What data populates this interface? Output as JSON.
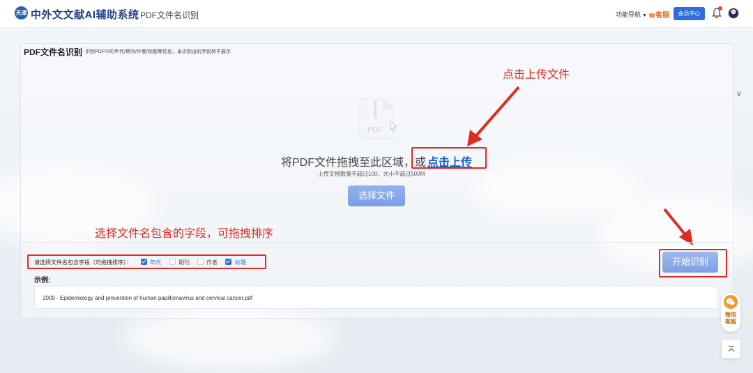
{
  "header": {
    "logo_text": "天津",
    "app_title": "中外文文献AI辅助系统",
    "page_crumb": "PDF文件名识别",
    "nav_menu": "功能导航",
    "kefu": "客服",
    "member_center": "会员中心"
  },
  "card": {
    "title": "PDF文件名识别",
    "subtitle": "识别PDF中的年代/期刊/作者/标题等信息，未识别出的字段将不展示"
  },
  "upload": {
    "icon_label": "PDF",
    "drop_text": "将PDF文件拖拽至此区域，或",
    "drop_link": "点击上传",
    "limit_text": "上传文档数量不超过100，大小不超过500M",
    "choose_button": "选择文件"
  },
  "annotations": {
    "upload_hint": "点击上传文件",
    "fields_hint": "选择文件名包含的字段，可拖拽排序"
  },
  "fields": {
    "label": "请选择文件名包含字段（可拖拽排序）：",
    "options": [
      {
        "label": "年代",
        "checked": true
      },
      {
        "label": "期刊",
        "checked": false
      },
      {
        "label": "作者",
        "checked": false
      },
      {
        "label": "标题",
        "checked": true
      }
    ]
  },
  "start_button": "开始识别",
  "example": {
    "label": "示例:",
    "text": "2009 - Epidemiology and prevention of human papillomavirus and cervical cancer.pdf"
  },
  "float": {
    "service_text_1": "微信",
    "service_text_2": "客服",
    "top_icon": "▲"
  },
  "side_mark": "V"
}
